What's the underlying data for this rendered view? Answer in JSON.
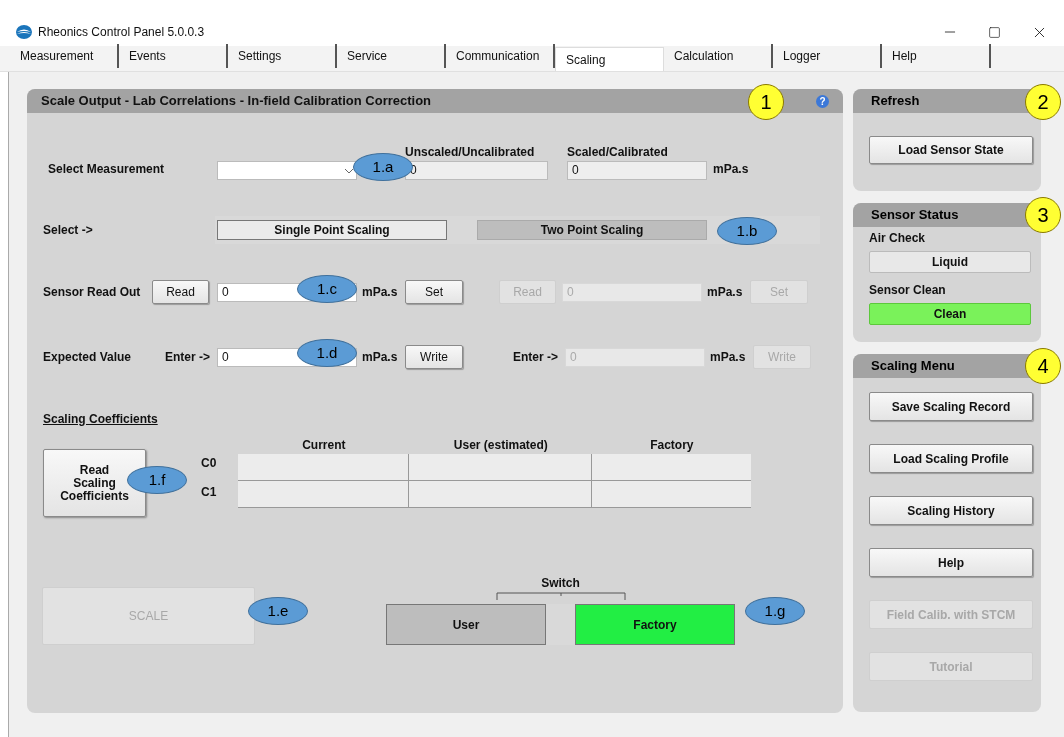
{
  "window": {
    "title": "Rheonics Control Panel 5.0.0.3"
  },
  "tabs": [
    {
      "label": "Measurement",
      "selected": false
    },
    {
      "label": "Events",
      "selected": false
    },
    {
      "label": "Settings",
      "selected": false
    },
    {
      "label": "Service",
      "selected": false
    },
    {
      "label": "Communication",
      "selected": false
    },
    {
      "label": "Scaling",
      "selected": true
    },
    {
      "label": "Calculation",
      "selected": false
    },
    {
      "label": "Logger",
      "selected": false
    },
    {
      "label": "Help",
      "selected": false
    }
  ],
  "main_panel": {
    "title": "Scale Output - Lab Correlations - In-field Calibration Correction",
    "help_icon": "?",
    "select_measurement": {
      "label": "Select Measurement",
      "unscaled": {
        "heading": "Unscaled/Uncalibrated",
        "value": "0"
      },
      "scaled": {
        "heading": "Scaled/Calibrated",
        "value": "0"
      },
      "unit": "mPa.s"
    },
    "select": {
      "label": "Select ->",
      "options": [
        {
          "label": "Single Point Scaling",
          "selected": true
        },
        {
          "label": "Two Point Scaling",
          "selected": false
        }
      ]
    },
    "sensor_readout": {
      "label": "Sensor Read Out",
      "points": [
        {
          "read": {
            "label": "Read",
            "disabled": false
          },
          "value": "0",
          "disabled": false,
          "unit": "mPa.s",
          "set": {
            "label": "Set",
            "disabled": false
          }
        },
        {
          "read": {
            "label": "Read",
            "disabled": true
          },
          "value": "0",
          "disabled": true,
          "unit": "mPa.s",
          "set": {
            "label": "Set",
            "disabled": true
          }
        }
      ]
    },
    "expected_value": {
      "label": "Expected Value",
      "points": [
        {
          "prefix": "Enter ->",
          "value": "0",
          "disabled": false,
          "unit": "mPa.s",
          "write": {
            "label": "Write",
            "disabled": false
          }
        },
        {
          "prefix": "Enter ->",
          "value": "0",
          "disabled": true,
          "unit": "mPa.s",
          "write": {
            "label": "Write",
            "disabled": true
          }
        }
      ]
    },
    "coefficients": {
      "title": "Scaling Coefficients",
      "read_button": "Read Scaling Coefficients",
      "row_labels": [
        "C0",
        "C1"
      ],
      "columns": [
        "Current",
        "User (estimated)",
        "Factory"
      ]
    },
    "scale_button": {
      "label": "SCALE",
      "disabled": true
    },
    "switch": {
      "label": "Switch",
      "options": [
        {
          "label": "User",
          "selected": false
        },
        {
          "label": "Factory",
          "selected": true
        }
      ]
    }
  },
  "refresh": {
    "title": "Refresh",
    "buttons": [
      {
        "label": "Load Sensor State",
        "disabled": false
      }
    ]
  },
  "sensor_status": {
    "title": "Sensor Status",
    "items": [
      {
        "label": "Air Check",
        "status": "Liquid",
        "on": false
      },
      {
        "label": "Sensor Clean",
        "status": "Clean",
        "on": true
      }
    ]
  },
  "scaling_menu": {
    "title": "Scaling Menu",
    "buttons": [
      {
        "label": "Save Scaling Record",
        "disabled": false
      },
      {
        "label": "Load Scaling Profile",
        "disabled": false
      },
      {
        "label": "Scaling History",
        "disabled": false
      },
      {
        "label": "Help",
        "disabled": false
      },
      {
        "label": "Field Calib. with STCM",
        "disabled": true
      },
      {
        "label": "Tutorial",
        "disabled": true
      }
    ]
  },
  "callouts": [
    {
      "label": "1",
      "kind": "number"
    },
    {
      "label": "2",
      "kind": "number"
    },
    {
      "label": "3",
      "kind": "number"
    },
    {
      "label": "4",
      "kind": "number"
    },
    {
      "label": "1.a",
      "kind": "tag"
    },
    {
      "label": "1.b",
      "kind": "tag"
    },
    {
      "label": "1.c",
      "kind": "tag"
    },
    {
      "label": "1.d",
      "kind": "tag"
    },
    {
      "label": "1.e",
      "kind": "tag"
    },
    {
      "label": "1.f",
      "kind": "tag"
    },
    {
      "label": "1.g",
      "kind": "tag"
    }
  ]
}
